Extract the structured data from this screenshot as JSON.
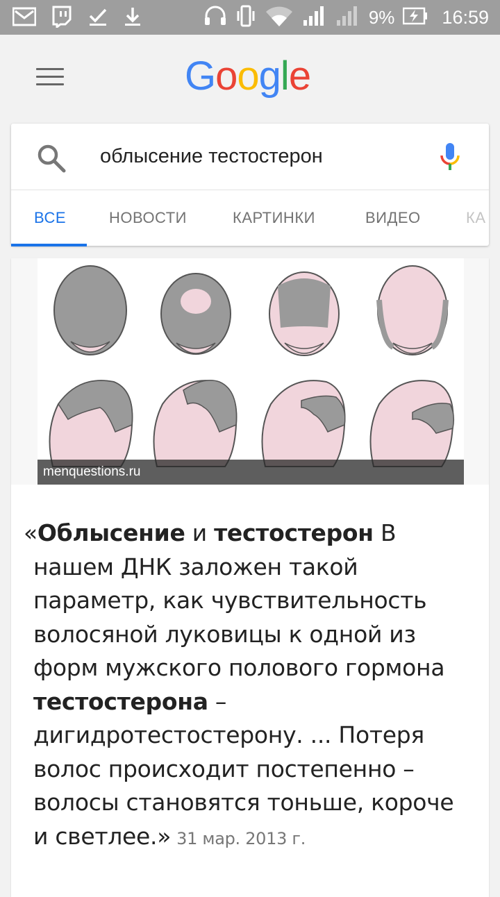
{
  "status_bar": {
    "battery": "9%",
    "time": "16:59"
  },
  "header": {
    "logo": [
      "G",
      "o",
      "o",
      "g",
      "l",
      "e"
    ]
  },
  "search": {
    "query": "облысение тестостерон"
  },
  "tabs": [
    {
      "label": "ВСЕ"
    },
    {
      "label": "НОВОСТИ"
    },
    {
      "label": "КАРТИНКИ"
    },
    {
      "label": "ВИДЕО"
    },
    {
      "label": "КА"
    }
  ],
  "result": {
    "image_source": "menquestions.ru",
    "quote_open": "«",
    "bold1": "Облысение",
    "text1": " и ",
    "bold2": "тестостерон",
    "text2": " В нашем ДНК заложен такой параметр, как чувствительность волосяной луковицы к одной из форм мужского полового гормона ",
    "bold3": "тестостерона",
    "text3": " – дигидротестостерону. ... Потеря волос происходит постепенно – волосы становятся тоньше, короче и светлее.»",
    "date": "31 мар. 2013 г."
  },
  "colors": {
    "status_bar": "#9e9e9e",
    "accent": "#1a73e8",
    "google_blue": "#4285f4",
    "google_red": "#ea4335",
    "google_yellow": "#fbbc05",
    "google_green": "#34a853"
  }
}
